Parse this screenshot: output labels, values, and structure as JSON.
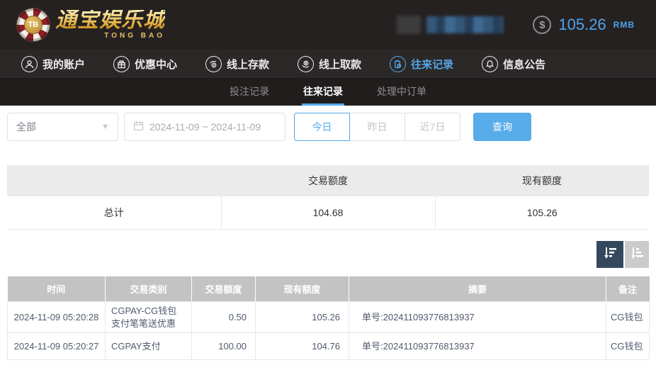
{
  "header": {
    "logo_title": "通宝娱乐城",
    "logo_subtitle": "TONG BAO",
    "logo_chip_text": "TB",
    "currency_symbol": "$",
    "balance": "105.26",
    "currency": "RMB"
  },
  "nav": {
    "items": [
      {
        "label": "我的账户",
        "icon": "user-icon",
        "active": false
      },
      {
        "label": "优惠中心",
        "icon": "gift-icon",
        "active": false
      },
      {
        "label": "线上存款",
        "icon": "deposit-icon",
        "active": false
      },
      {
        "label": "线上取款",
        "icon": "withdraw-icon",
        "active": false
      },
      {
        "label": "往来记录",
        "icon": "records-icon",
        "active": true
      },
      {
        "label": "信息公告",
        "icon": "bell-icon",
        "active": false
      }
    ]
  },
  "sub_tabs": [
    {
      "label": "投注记录",
      "active": false
    },
    {
      "label": "往来记录",
      "active": true
    },
    {
      "label": "处理中订单",
      "active": false
    }
  ],
  "filters": {
    "type_select_value": "全部",
    "select_caret": "▼",
    "date_range": "2024-11-09 ~ 2024-11-09",
    "quick_buttons": [
      {
        "label": "今日",
        "active": true
      },
      {
        "label": "昨日",
        "active": false
      },
      {
        "label": "近7日",
        "active": false
      }
    ],
    "search_label": "查询"
  },
  "summary_table": {
    "headers": [
      "",
      "交易额度",
      "现有额度"
    ],
    "row": {
      "label": "总计",
      "trade_amount": "104.68",
      "current_amount": "105.26"
    }
  },
  "sorting": {
    "descending_active": true,
    "ascending_active": false
  },
  "main_table": {
    "headers": [
      "时间",
      "交易类别",
      "交易额度",
      "现有额度",
      "摘要",
      "备注"
    ],
    "rows": [
      {
        "time": "2024-11-09 05:20:28",
        "type": "CGPAY-CG钱包支付笔笔送优惠",
        "amount": "0.50",
        "balance": "105.26",
        "summary": "单号:202411093776813937",
        "note": "CG钱包"
      },
      {
        "time": "2024-11-09 05:20:27",
        "type": "CGPAY支付",
        "amount": "100.00",
        "balance": "104.76",
        "summary": "单号:202411093776813937",
        "note": "CG钱包"
      }
    ]
  },
  "colors": {
    "accent_blue": "#55a6e8",
    "balance_blue": "#4da3f0",
    "header_bg": "#262121",
    "nav_bg": "#2b2828",
    "subtab_bg": "#211d1d",
    "gold": "#e9bb4d",
    "table_header_bg": "#c3c3c3",
    "summary_header_bg": "#ebebeb",
    "sort_active_bg": "#34495e",
    "sort_inactive_bg": "#cbcbcb",
    "search_button_bg": "#58ace9"
  }
}
